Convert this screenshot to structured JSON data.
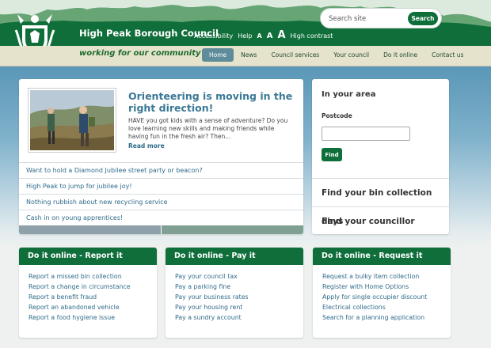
{
  "header": {
    "site_title": "High Peak Borough Council",
    "accessibility": "Accessibility",
    "help": "Help",
    "text_size": [
      "A",
      "A",
      "A"
    ],
    "high_contrast": "High contrast",
    "search": {
      "placeholder": "Search site",
      "button": "Search"
    }
  },
  "nav": {
    "tagline": "working for our community",
    "items": [
      "Home",
      "News",
      "Council services",
      "Your council",
      "Do it online",
      "Contact us"
    ],
    "active": "Home"
  },
  "feature": {
    "title": "Orienteering is moving in the right direction!",
    "text": "HAVE you got kids with a sense of adventure? Do you love learning new skills and making friends while having fun in the fresh air? Then...",
    "read_more": "Read more"
  },
  "news": [
    "Want to hold a Diamond Jubilee street party or beacon?",
    "High Peak to jump for jubilee joy!",
    "Nothing rubbish about new recycling service",
    "Cash in on young apprentices!"
  ],
  "sidebar": {
    "heading": "In your area",
    "postcode_label": "Postcode",
    "find_button": "Find",
    "bin_link": "Find your bin collection days",
    "councillor_link": "Find your councillor"
  },
  "cards": [
    {
      "title": "Do it online - Report it",
      "links": [
        "Report a missed bin collection",
        "Report a change in circumstance",
        "Report a benefit fraud",
        "Report an abandoned vehicle",
        "Report a food hygiene issue"
      ]
    },
    {
      "title": "Do it online - Pay it",
      "links": [
        "Pay your council tax",
        "Pay a parking fine",
        "Pay your business rates",
        "Pay your housing rent",
        "Pay a sundry account"
      ]
    },
    {
      "title": "Do it online - Request it",
      "links": [
        "Request a bulky item collection",
        "Register with Home Options",
        "Apply for single occupier discount",
        "Electrical collections",
        "Search for a planning application"
      ]
    }
  ],
  "colors": {
    "brand_green": "#0f6e3a",
    "link_blue": "#2f6b8a",
    "title_blue": "#3b7896",
    "nav_active": "#5f8c9b"
  }
}
